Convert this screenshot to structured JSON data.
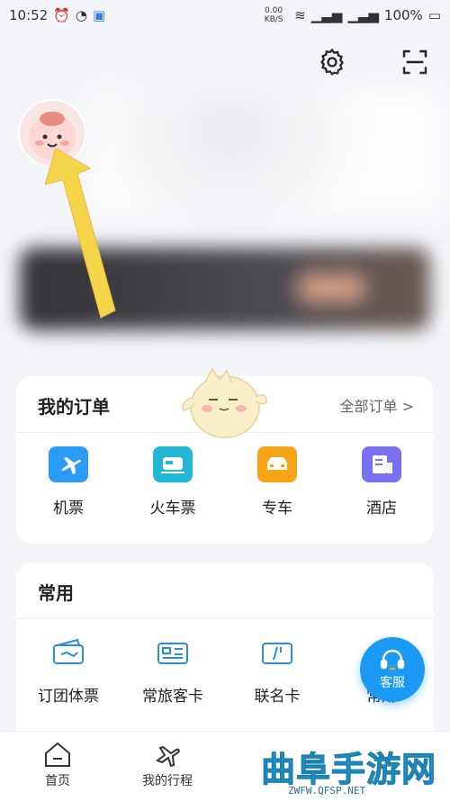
{
  "status_bar": {
    "time": "10:52",
    "speed": "0.00 KB/S",
    "battery": "100%"
  },
  "top_actions": {
    "settings_icon": "gear-icon",
    "scan_icon": "scan-icon"
  },
  "orders": {
    "title": "我的订单",
    "all_link": "全部订单 >",
    "items": [
      {
        "label": "机票",
        "icon": "plane-ticket-icon",
        "color": "#2b9cf6"
      },
      {
        "label": "火车票",
        "icon": "train-ticket-icon",
        "color": "#23b7d6"
      },
      {
        "label": "专车",
        "icon": "car-icon",
        "color": "#f6a316"
      },
      {
        "label": "酒店",
        "icon": "hotel-icon",
        "color": "#7b6ff2"
      }
    ]
  },
  "common": {
    "title": "常用",
    "items": [
      {
        "label": "订团体票",
        "icon": "group-ticket-icon"
      },
      {
        "label": "常旅客卡",
        "icon": "frequent-flyer-card-icon"
      },
      {
        "label": "联名卡",
        "icon": "co-branded-card-icon"
      },
      {
        "label": "常用",
        "icon": "common-icon"
      }
    ]
  },
  "fab": {
    "label": "客服"
  },
  "tabbar": {
    "items": [
      {
        "label": "首页",
        "icon": "home-icon"
      },
      {
        "label": "我的行程",
        "icon": "plane-icon"
      }
    ]
  },
  "watermark": {
    "text": "曲阜手游网",
    "sub": "ZWFW.QFSP.NET"
  }
}
